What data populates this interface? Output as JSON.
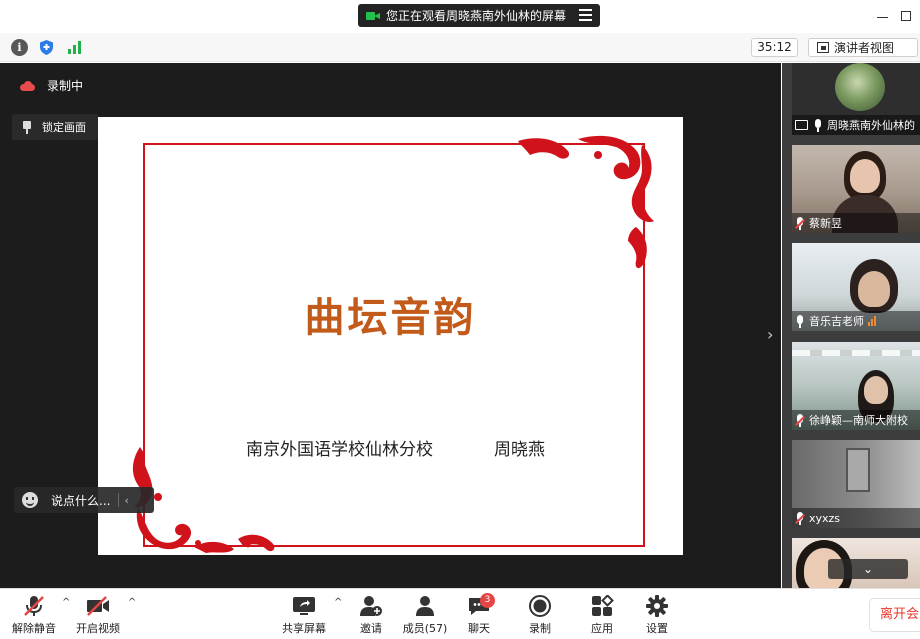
{
  "window": {
    "share_notice": "您正在观看周晓燕南外仙林的屏幕"
  },
  "infobar": {
    "timer": "35:12",
    "view_label": "演讲者视图"
  },
  "stage": {
    "recording_label": "录制中",
    "lock_label": "锁定画面",
    "chat_placeholder": "说点什么...",
    "slide": {
      "title": "曲坛音韵",
      "subtitle": "南京外国语学校仙林分校",
      "author": "周晓燕",
      "accent_color": "#c25a1a",
      "frame_color": "#d0121b"
    }
  },
  "gallery": {
    "participants": [
      {
        "name": "周晓燕南外仙林的",
        "mic": "on",
        "sharing": true
      },
      {
        "name": "蔡新昱",
        "mic": "muted"
      },
      {
        "name": "音乐吉老师",
        "mic": "on",
        "speaking": true
      },
      {
        "name": "徐峥颖—南师大附校",
        "mic": "muted"
      },
      {
        "name": "xyxzs",
        "mic": "muted"
      },
      {
        "name": "",
        "mic": "on"
      }
    ]
  },
  "toolbar": {
    "unmute": "解除静音",
    "start_video": "开启视频",
    "share_screen": "共享屏幕",
    "invite": "邀请",
    "participants": "成员(57)",
    "chat": "聊天",
    "chat_badge": "3",
    "record": "录制",
    "apps": "应用",
    "settings": "设置",
    "leave": "离开会"
  }
}
